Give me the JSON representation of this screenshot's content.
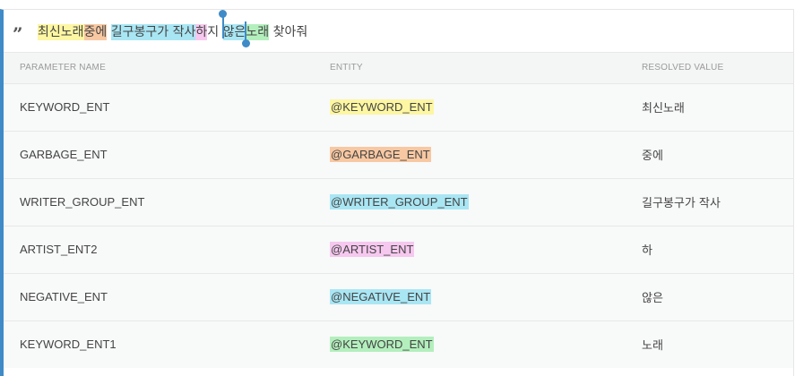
{
  "phrase": {
    "segments": [
      {
        "text": "최신노래",
        "color": "#fdf6a2"
      },
      {
        "text": "중에",
        "color": "#f8c8a2"
      },
      {
        "text": " ",
        "color": ""
      },
      {
        "text": "길구봉구가 작사",
        "color": "#a9e6f4"
      },
      {
        "text": "하",
        "color": "#f6c8ef"
      },
      {
        "text": "지 ",
        "color": ""
      },
      {
        "text": "않은",
        "color": "#a9e6f4"
      },
      {
        "text": "노래",
        "color": "#b3efbd"
      },
      {
        "text": " 찾아줘",
        "color": ""
      }
    ]
  },
  "table": {
    "headers": [
      "PARAMETER NAME",
      "ENTITY",
      "RESOLVED VALUE"
    ],
    "rows": [
      {
        "param": "KEYWORD_ENT",
        "entity": "@KEYWORD_ENT",
        "resolved": "최신노래",
        "color": "#fdf6a2"
      },
      {
        "param": "GARBAGE_ENT",
        "entity": "@GARBAGE_ENT",
        "resolved": "중에",
        "color": "#f8c8a2"
      },
      {
        "param": "WRITER_GROUP_ENT",
        "entity": "@WRITER_GROUP_ENT",
        "resolved": "길구봉구가 작사",
        "color": "#a9e6f4"
      },
      {
        "param": "ARTIST_ENT2",
        "entity": "@ARTIST_ENT",
        "resolved": "하",
        "color": "#f6c8ef"
      },
      {
        "param": "NEGATIVE_ENT",
        "entity": "@NEGATIVE_ENT",
        "resolved": "않은",
        "color": "#a9e6f4"
      },
      {
        "param": "KEYWORD_ENT1",
        "entity": "@KEYWORD_ENT",
        "resolved": "노래",
        "color": "#b3efbd"
      }
    ]
  },
  "colors": {
    "accent": "#3f8bc8"
  }
}
